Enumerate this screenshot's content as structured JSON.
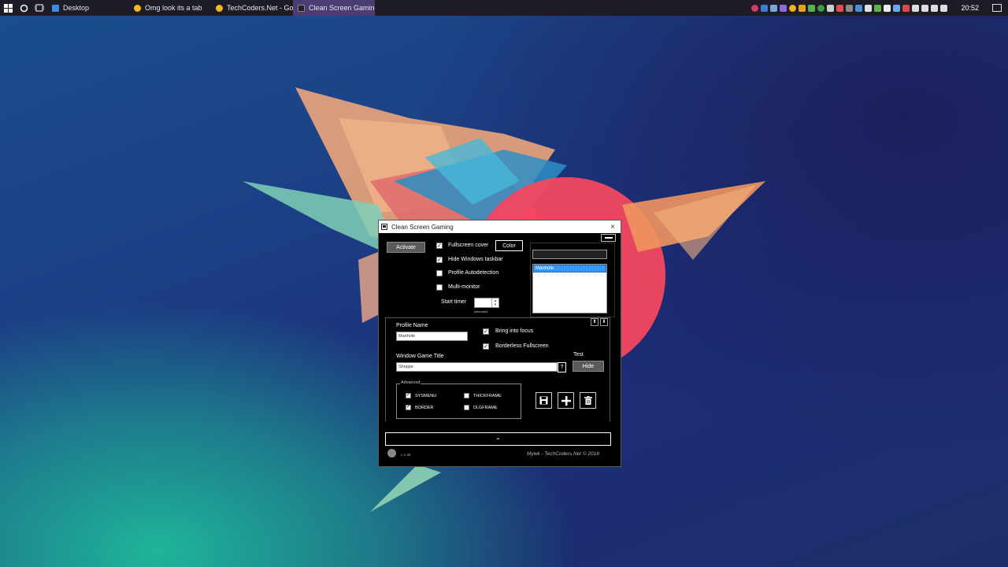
{
  "taskbar": {
    "tasks": [
      {
        "label": "Desktop",
        "active": false
      },
      {
        "label": "Omg look its a tab",
        "active": false
      },
      {
        "label": "TechCoders.Net - Go...",
        "active": false
      },
      {
        "label": "Clean Screen Gaming",
        "active": true
      }
    ],
    "clock": "20:52"
  },
  "window": {
    "title": "Clean Screen Gaming",
    "close_glyph": "×",
    "activate_label": "Activate",
    "color_label": "Color",
    "options": [
      {
        "label": "Fullscreen cover",
        "checked": true
      },
      {
        "label": "Hide Windows taskbar",
        "checked": true
      },
      {
        "label": "Profile Autodetection",
        "checked": false
      },
      {
        "label": "Multi-monitor",
        "checked": false
      }
    ],
    "start_timer_label": "Start timer",
    "seconds_label": "(seconds)",
    "profiles": [
      "Manhole"
    ],
    "selected_profile": "Manhole",
    "profile_name_label": "Profile Name",
    "profile_name_value": "Manhole",
    "bring_into_focus": {
      "label": "Bring into focus",
      "checked": true
    },
    "borderless_fullscreen": {
      "label": "Borderless Fullscreen",
      "checked": true
    },
    "window_game_title_label": "Window Game Title",
    "window_game_title_value": "Shoppe",
    "question_label": "?",
    "test_label": "Test",
    "hide_label": "Hide",
    "advanced_label": "Advanced",
    "advanced_flags": [
      {
        "label": "SYSMENU",
        "checked": true
      },
      {
        "label": "THICKFRAME",
        "checked": false
      },
      {
        "label": "BORDER",
        "checked": true
      },
      {
        "label": "DLGFRAME",
        "checked": false
      }
    ],
    "version": "v 2.36",
    "credit": "Mywk - TechCoders.Net © 2016"
  },
  "colors": {
    "active_task": "#4b3d73",
    "selection": "#3399ff"
  }
}
